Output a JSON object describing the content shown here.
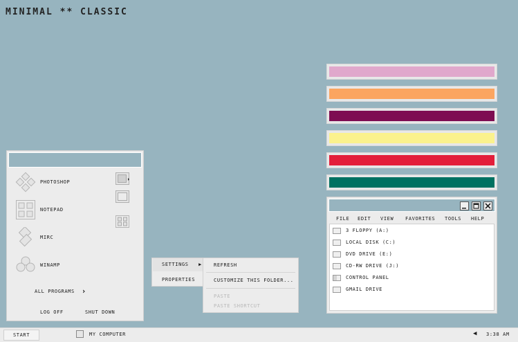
{
  "desktop": {
    "title": "MINIMAL ** CLASSIC",
    "background": "#97b4bf"
  },
  "swatches": [
    "#e0a8cc",
    "#fba560",
    "#7e0d52",
    "#fbf28d",
    "#e31e3a",
    "#007161"
  ],
  "start_menu": {
    "programs": [
      {
        "label": "PHOTOSHOP",
        "icon": "gamepad-icon"
      },
      {
        "label": "NOTEPAD",
        "icon": "grid-icon"
      },
      {
        "label": "MIRC",
        "icon": "diamond-icon"
      },
      {
        "label": "WINAMP",
        "icon": "rings-icon"
      }
    ],
    "side_icons": [
      "document-icon",
      "window-icon",
      "grid-icon"
    ],
    "all_programs": "ALL PROGRAMS",
    "log_off": "LOG OFF",
    "shut_down": "SHUT DOWN"
  },
  "context_menu": {
    "settings": "SETTINGS",
    "properties": "PROPERTIES",
    "submenu": {
      "refresh": "REFRESH",
      "customize": "CUSTOMIZE THIS FOLDER...",
      "paste": "PASTE",
      "paste_shortcut": "PASTE SHORTCUT"
    }
  },
  "explorer": {
    "menu": [
      "FILE",
      "EDIT",
      "VIEW",
      "FAVORITES",
      "TOOLS",
      "HELP"
    ],
    "items": [
      "3  FLOPPY (A:)",
      "LOCAL DISK (C:)",
      "DVD DRIVE (E:)",
      "CD-RW DRIVE (J:)",
      "CONTROL PANEL",
      "GMAIL DRIVE"
    ]
  },
  "taskbar": {
    "start": "START",
    "task": "MY COMPUTER",
    "clock": "3:38 AM"
  }
}
